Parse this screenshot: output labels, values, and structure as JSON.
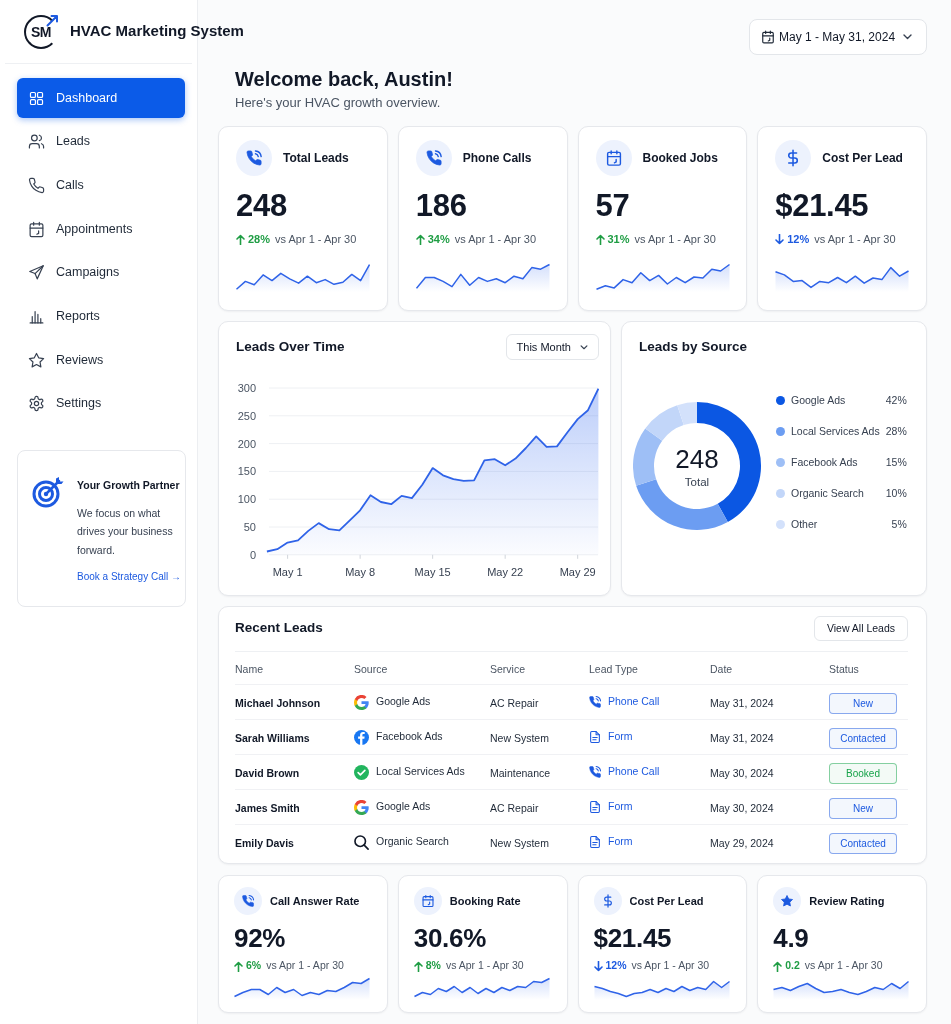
{
  "header": {
    "logo_text": "SM",
    "app_name": "HVAC Marketing System"
  },
  "sidebar": {
    "items": [
      {
        "label": "Dashboard",
        "kind": "dashboard",
        "selected": true
      },
      {
        "label": "Leads",
        "kind": "leads",
        "selected": false
      },
      {
        "label": "Calls",
        "kind": "calls",
        "selected": false
      },
      {
        "label": "Appointments",
        "kind": "appointments",
        "selected": false
      },
      {
        "label": "Campaigns",
        "kind": "campaigns",
        "selected": false
      },
      {
        "label": "Reports",
        "kind": "reports",
        "selected": false
      },
      {
        "label": "Reviews",
        "kind": "reviews",
        "selected": false
      },
      {
        "label": "Settings",
        "kind": "settings",
        "selected": false
      }
    ],
    "promo": {
      "title": "Your Growth Partner",
      "text": "We focus on what drives your business forward.",
      "link": "Book a Strategy Call →"
    }
  },
  "date_range": "May 1 - May 31, 2024",
  "welcome": {
    "title": "Welcome back, Austin!",
    "subtitle": "Here's your HVAC growth overview."
  },
  "kpis": [
    {
      "kind": "phone",
      "title": "Total Leads",
      "value": "248",
      "increase": true,
      "change": "28%",
      "comparison": "vs Apr 1 - Apr 30"
    },
    {
      "kind": "phone",
      "title": "Phone Calls",
      "value": "186",
      "increase": true,
      "change": "34%",
      "comparison": "vs Apr 1 - Apr 30"
    },
    {
      "kind": "calendar",
      "title": "Booked Jobs",
      "value": "57",
      "increase": true,
      "change": "31%",
      "comparison": "vs Apr 1 - Apr 30"
    },
    {
      "kind": "dollar",
      "title": "Cost Per Lead",
      "value": "$21.45",
      "increase": false,
      "change": "12%",
      "comparison": "vs Apr 1 - Apr 30"
    }
  ],
  "leads_over_time": {
    "period": "This Month",
    "chart_data": {
      "type": "area",
      "title": "Leads Over Time",
      "categories": [
        null,
        null,
        "May 1",
        null,
        null,
        null,
        null,
        null,
        null,
        "May 8",
        null,
        null,
        null,
        null,
        null,
        null,
        "May 15",
        null,
        null,
        null,
        null,
        null,
        null,
        "May 22",
        null,
        null,
        null,
        null,
        null,
        null,
        "May 29",
        null,
        null
      ],
      "series": [
        {
          "color": "#2f63e8",
          "values": [
            6,
            10,
            22,
            26,
            43,
            57,
            46,
            44,
            62,
            80,
            107,
            95,
            91,
            106,
            102,
            126,
            156,
            143,
            136,
            133,
            134,
            170,
            172,
            161,
            173,
            192,
            213,
            194,
            195,
            220,
            244,
            260,
            299
          ]
        }
      ],
      "ylim": [
        0,
        300
      ],
      "yticks": [
        0,
        50,
        100,
        150,
        200,
        250,
        300
      ],
      "grid": true
    }
  },
  "leads_by_source": {
    "chart_data": {
      "type": "donut",
      "title": "Leads by Source",
      "categories": [
        "Google Ads",
        "Local Services Ads",
        "Facebook Ads",
        "Organic Search",
        "Other"
      ],
      "values": [
        42,
        28,
        15,
        10,
        5
      ]
    },
    "center_value": "248",
    "center_label": "Total",
    "legend": [
      {
        "percent": "42%",
        "color": "#0b57e3"
      },
      {
        "percent": "28%",
        "color": "#6c9df2"
      },
      {
        "percent": "15%",
        "color": "#9ebff6"
      },
      {
        "percent": "10%",
        "color": "#c2d6f9"
      },
      {
        "percent": "5%",
        "color": "#d3e1fb"
      }
    ]
  },
  "recent_leads": {
    "title": "Recent Leads",
    "button": "View All Leads",
    "columns": [
      "Name",
      "Source",
      "Service",
      "Lead Type",
      "Date",
      "Status"
    ],
    "rows": [
      {
        "name": "Michael Johnson",
        "source": {
          "kind": "g",
          "label": "Google Ads"
        },
        "service": "AC Repair",
        "lead_type": {
          "kind": "call",
          "label": "Phone Call"
        },
        "date": "May 31, 2024",
        "status": {
          "label": "New",
          "color": "#1d5ae0"
        }
      },
      {
        "name": "Sarah Williams",
        "source": {
          "kind": "f",
          "label": "Facebook Ads"
        },
        "service": "New System",
        "lead_type": {
          "kind": "form",
          "label": "Form"
        },
        "date": "May 31, 2024",
        "status": {
          "label": "Contacted",
          "color": "#1d5ae0"
        }
      },
      {
        "name": "David Brown",
        "source": {
          "kind": "check",
          "label": "Local Services Ads"
        },
        "service": "Maintenance",
        "lead_type": {
          "kind": "call",
          "label": "Phone Call"
        },
        "date": "May 30, 2024",
        "status": {
          "label": "Booked",
          "color": "#16a34a"
        }
      },
      {
        "name": "James Smith",
        "source": {
          "kind": "g",
          "label": "Google Ads"
        },
        "service": "AC Repair",
        "lead_type": {
          "kind": "form",
          "label": "Form"
        },
        "date": "May 30, 2024",
        "status": {
          "label": "New",
          "color": "#1d5ae0"
        }
      },
      {
        "name": "Emily Davis",
        "source": {
          "kind": "search",
          "label": "Organic Search"
        },
        "service": "New System",
        "lead_type": {
          "kind": "form",
          "label": "Form"
        },
        "date": "May 29, 2024",
        "status": {
          "label": "Contacted",
          "color": "#1d5ae0"
        }
      }
    ]
  },
  "metrics": [
    {
      "kind": "phone",
      "title": "Call Answer Rate",
      "value": "92%",
      "increase": true,
      "change": "6%",
      "comparison": "vs Apr 1 - Apr 30"
    },
    {
      "kind": "calendar",
      "title": "Booking Rate",
      "value": "30.6%",
      "increase": true,
      "change": "8%",
      "comparison": "vs Apr 1 - Apr 30"
    },
    {
      "kind": "dollar",
      "title": "Cost Per Lead",
      "value": "$21.45",
      "increase": false,
      "change": "12%",
      "comparison": "vs Apr 1 - Apr 30"
    },
    {
      "kind": "star",
      "title": "Review Rating",
      "value": "4.9",
      "increase": true,
      "change": "0.2",
      "comparison": "vs Apr 1 - Apr 30"
    }
  ]
}
